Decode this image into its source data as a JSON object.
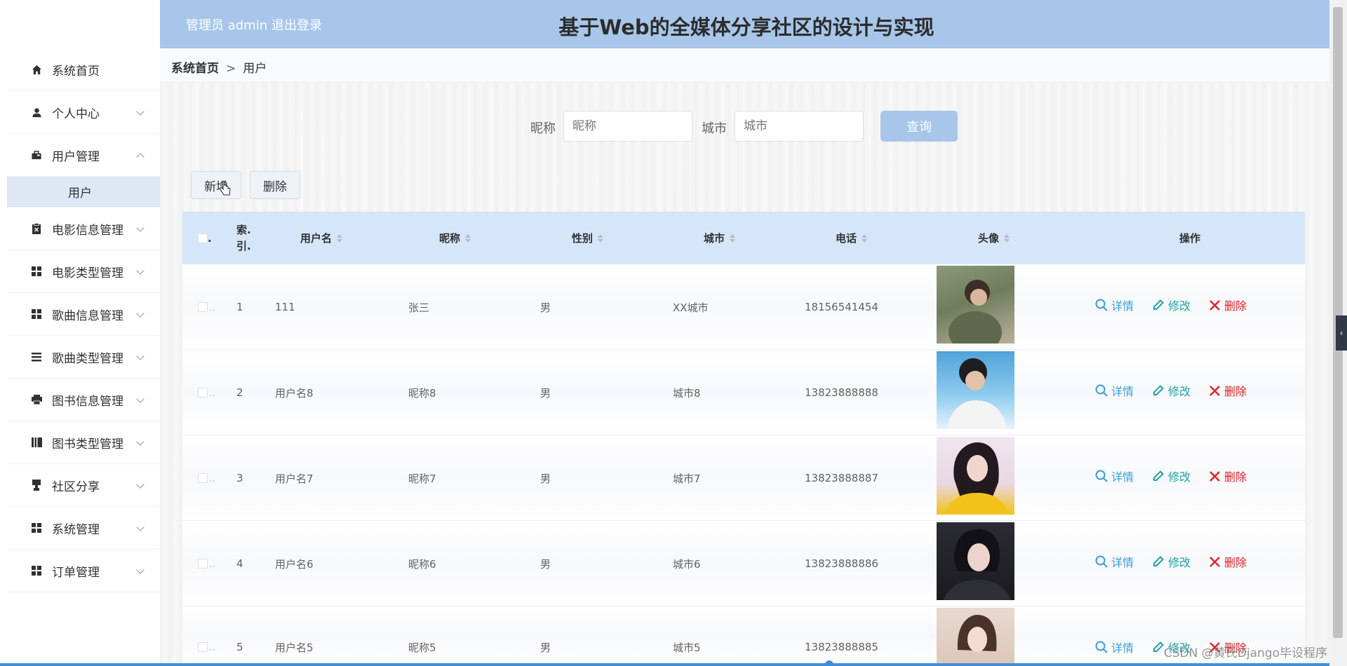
{
  "header": {
    "admin_text": "管理员 admin",
    "logout_label": "退出登录",
    "title": "基于Web的全媒体分享社区的设计与实现"
  },
  "breadcrumb": {
    "home": "系统首页",
    "separator": ">",
    "current": "用户"
  },
  "sidebar": {
    "items": [
      {
        "label": "系统首页",
        "icon": "home-icon"
      },
      {
        "label": "个人中心",
        "icon": "user-icon"
      },
      {
        "label": "用户管理",
        "icon": "briefcase-icon",
        "expanded": true
      },
      {
        "label": "电影信息管理",
        "icon": "clipboard-icon"
      },
      {
        "label": "电影类型管理",
        "icon": "grid-icon"
      },
      {
        "label": "歌曲信息管理",
        "icon": "grid-icon"
      },
      {
        "label": "歌曲类型管理",
        "icon": "list-icon"
      },
      {
        "label": "图书信息管理",
        "icon": "printer-icon"
      },
      {
        "label": "图书类型管理",
        "icon": "book-icon"
      },
      {
        "label": "社区分享",
        "icon": "stamp-icon"
      },
      {
        "label": "系统管理",
        "icon": "grid-icon"
      },
      {
        "label": "订单管理",
        "icon": "grid-icon"
      }
    ],
    "subitem": "用户"
  },
  "search": {
    "nickname_label": "昵称",
    "nickname_placeholder": "昵称",
    "city_label": "城市",
    "city_placeholder": "城市",
    "query_label": "查询"
  },
  "actions": {
    "add_label": "新增",
    "delete_label": "删除"
  },
  "table": {
    "headers": {
      "select": ".",
      "index": "索.\n引.",
      "username": "用户名",
      "nickname": "昵称",
      "gender": "性别",
      "city": "城市",
      "phone": "电话",
      "avatar": "头像",
      "ops": "操作"
    },
    "ops": {
      "detail": "详情",
      "edit": "修改",
      "delete": "删除"
    },
    "rows": [
      {
        "index": "1",
        "username": "111",
        "nickname": "张三",
        "gender": "男",
        "city": "XX城市",
        "phone": "18156541454"
      },
      {
        "index": "2",
        "username": "用户名8",
        "nickname": "昵称8",
        "gender": "男",
        "city": "城市8",
        "phone": "13823888888"
      },
      {
        "index": "3",
        "username": "用户名7",
        "nickname": "昵称7",
        "gender": "男",
        "city": "城市7",
        "phone": "13823888887"
      },
      {
        "index": "4",
        "username": "用户名6",
        "nickname": "昵称6",
        "gender": "男",
        "city": "城市6",
        "phone": "13823888886"
      },
      {
        "index": "5",
        "username": "用户名5",
        "nickname": "昵称5",
        "gender": "男",
        "city": "城市5",
        "phone": "13823888885"
      }
    ]
  },
  "watermark": "CSDN @黄氏Django毕设程序",
  "colors": {
    "header_bg": "#a7c6ea",
    "table_head_bg": "#d6e6f9",
    "detail": "#3a9fd8",
    "edit": "#1fa3a4",
    "delete": "#e0242b"
  }
}
